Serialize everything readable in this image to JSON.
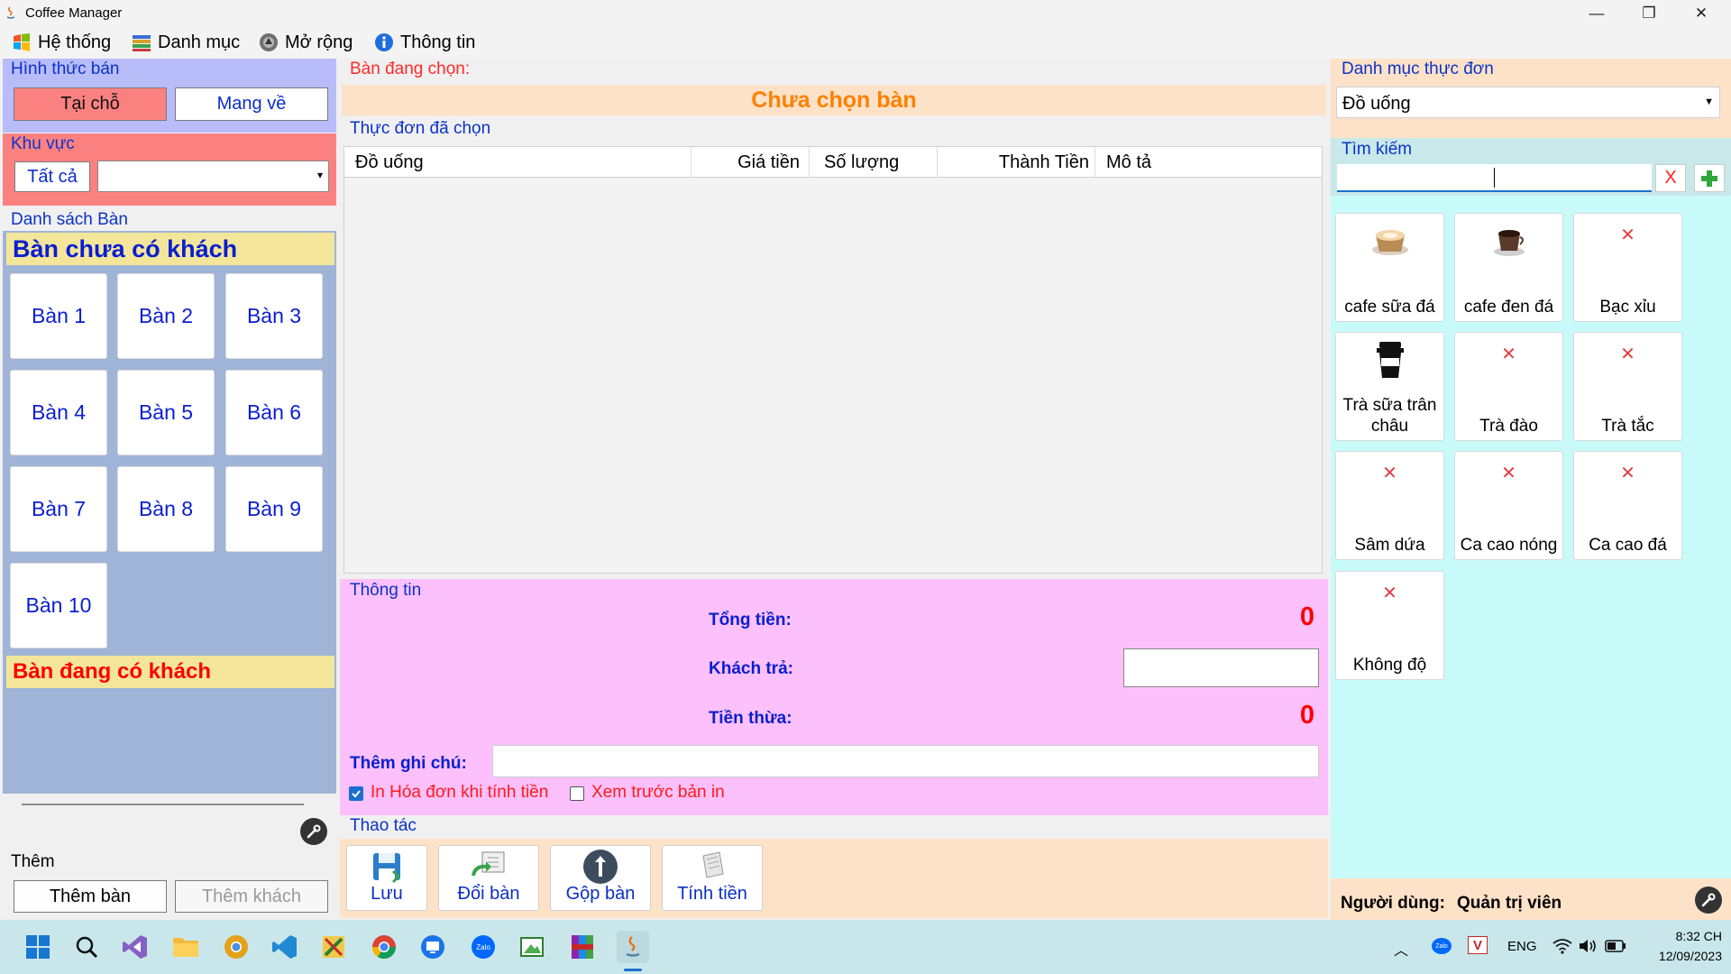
{
  "window": {
    "title": "Coffee Manager",
    "min_glyph": "—",
    "max_glyph": "❐",
    "close_glyph": "✕"
  },
  "menu": [
    {
      "label": "Hệ thống",
      "icon": "windows-flag-icon"
    },
    {
      "label": "Danh mục",
      "icon": "books-icon"
    },
    {
      "label": "Mở rộng",
      "icon": "disc-icon"
    },
    {
      "label": "Thông tin",
      "icon": "info-icon"
    }
  ],
  "left": {
    "sale_type": {
      "title": "Hình thức bán",
      "dine_in": "Tại chỗ",
      "take_away": "Mang về"
    },
    "area": {
      "title": "Khu vực",
      "all_button": "Tất cả",
      "select_value": ""
    },
    "tables": {
      "title": "Danh sách Bàn",
      "empty_header": "Bàn chưa có khách",
      "busy_header": "Bàn đang có khách",
      "items": [
        "Bàn 1",
        "Bàn 2",
        "Bàn 3",
        "Bàn 4",
        "Bàn 5",
        "Bàn 6",
        "Bàn 7",
        "Bàn 8",
        "Bàn 9",
        "Bàn 10"
      ]
    },
    "add": {
      "title": "Thêm",
      "add_table": "Thêm bàn",
      "add_customer": "Thêm khách"
    }
  },
  "center": {
    "selected_table_label": "Bàn đang chọn:",
    "selected_table_value": "Chưa chọn bàn",
    "order_title": "Thực đơn đã chọn",
    "columns": [
      "Đồ uống",
      "Giá tiền",
      "Số lượng",
      "Thành Tiền",
      "Mô tả"
    ],
    "info": {
      "title": "Thông tin",
      "total_label": "Tổng tiền:",
      "total_value": "0",
      "paid_label": "Khách trả:",
      "paid_value": "",
      "change_label": "Tiền thừa:",
      "change_value": "0",
      "note_label": "Thêm ghi chú:",
      "note_value": "",
      "print_on_pay": "In Hóa đơn khi tính tiền",
      "preview_print": "Xem trước bản in"
    },
    "actions": {
      "title": "Thao tác",
      "save": "Lưu",
      "change_table": "Đổi bàn",
      "merge_table": "Gộp bàn",
      "checkout": "Tính tiền"
    }
  },
  "right": {
    "category_title": "Danh mục thực đơn",
    "category_value": "Đồ uống",
    "search_title": "Tìm kiếm",
    "search_value": "",
    "clear_label": "X",
    "products": [
      {
        "name": "cafe sữa đá",
        "icon": "latte-cup-icon"
      },
      {
        "name": "cafe đen đá",
        "icon": "black-coffee-icon"
      },
      {
        "name": "Bạc xỉu",
        "icon": "broken-image-icon"
      },
      {
        "name": "Trà sữa trân châu",
        "icon": "takeaway-cup-icon"
      },
      {
        "name": "Trà đào",
        "icon": "broken-image-icon"
      },
      {
        "name": "Trà tắc",
        "icon": "broken-image-icon"
      },
      {
        "name": "Sâm dứa",
        "icon": "broken-image-icon"
      },
      {
        "name": "Ca cao nóng",
        "icon": "broken-image-icon"
      },
      {
        "name": "Ca cao đá",
        "icon": "broken-image-icon"
      },
      {
        "name": "Không độ",
        "icon": "broken-image-icon"
      }
    ],
    "user_label": "Người dùng:",
    "user_value": "Quản trị viên"
  },
  "taskbar": {
    "lang": "ENG",
    "time": "8:32 CH",
    "date": "12/09/2023"
  },
  "colors": {
    "sale_bg": "#b8bcf8",
    "area_bg": "#fb8181",
    "tables_bg": "#9fb4d6",
    "yellow_header": "#f3e69a",
    "peach": "#fde2c8",
    "pink": "#fcc0fc",
    "cyan": "#c8fafa",
    "taskbar": "#c9e7ea"
  }
}
